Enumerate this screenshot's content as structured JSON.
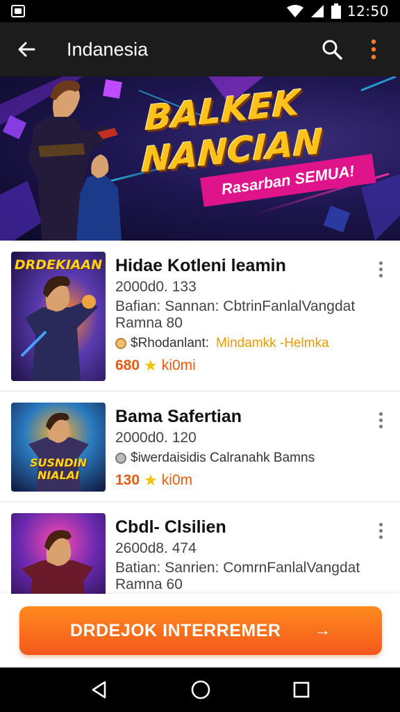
{
  "status_bar": {
    "time": "12:50",
    "icons": [
      "app-notification-icon",
      "wifi-icon",
      "signal-icon",
      "battery-icon"
    ]
  },
  "app_bar": {
    "title": "Indanesia",
    "icons": [
      "back-arrow-icon",
      "search-icon",
      "more-vert-icon"
    ]
  },
  "banner": {
    "title_line1": "BALKEK",
    "title_line2": "NANCIAN",
    "ribbon": "Rasarban SEMUA!"
  },
  "games": [
    {
      "thumb_caption": "DRDEKIAAN",
      "name": "Hidae Kotleni leamin",
      "meta": "2000d0. 133",
      "desc1": "Bafian: Sannan: CbtrinFanlalVangdat",
      "desc2": "Ramna 80",
      "tag": "$Rhodanlant:",
      "tag_accent": "Mindamkk -Helmka",
      "rating": "680",
      "rating_unit": "ki0mi"
    },
    {
      "thumb_caption": "SUSNDIN NIALAI",
      "name": "Bama Safertian",
      "meta": "2000d0. 120",
      "tag": "$iwerdaisidis Calranahk Bamns",
      "rating": "130",
      "rating_unit": "ki0m"
    },
    {
      "name": "Cbdl- Clsilien",
      "meta": "2600d8. 474",
      "desc1": "Batian: Sanrien: ComrnFanlalVangdat",
      "desc2": "Ramna 60"
    }
  ],
  "cta": {
    "label": "DRDEJOK INTERREMER",
    "arrow": "→"
  },
  "nav_bar": {
    "icons": [
      "back-triangle-icon",
      "home-circle-icon",
      "recents-square-icon"
    ]
  },
  "colors": {
    "accent": "#f4581c",
    "rating": "#e85a0c",
    "star": "#f6c000",
    "app_bar": "#1c1c1c"
  }
}
